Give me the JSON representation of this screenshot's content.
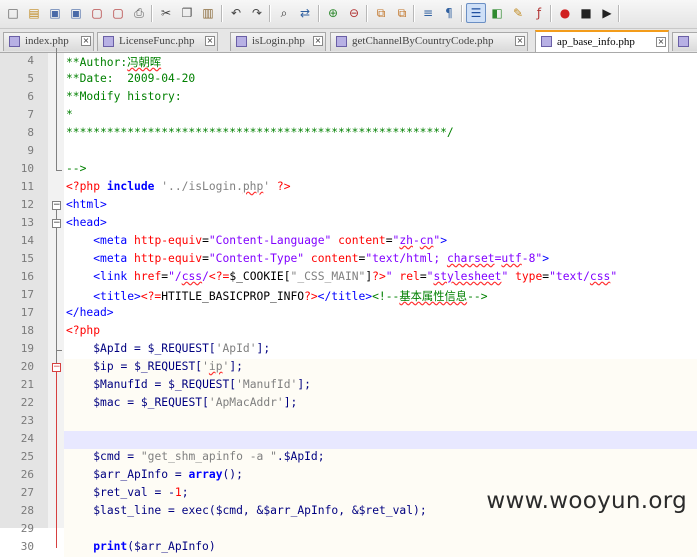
{
  "toolbar": {
    "buttons": [
      {
        "name": "new-file-icon",
        "glyph": "□",
        "color": "#5a5a5a"
      },
      {
        "name": "open-file-icon",
        "glyph": "▤",
        "color": "#c08a20"
      },
      {
        "name": "save-icon",
        "glyph": "▣",
        "color": "#4a6aa8"
      },
      {
        "name": "save-all-icon",
        "glyph": "▣",
        "color": "#4a6aa8"
      },
      {
        "name": "close-file-icon",
        "glyph": "▢",
        "color": "#b03030"
      },
      {
        "name": "close-all-icon",
        "glyph": "▢",
        "color": "#b03030"
      },
      {
        "name": "print-icon",
        "glyph": "⎙",
        "color": "#555555"
      },
      {
        "name": "cut-icon",
        "glyph": "✂",
        "color": "#444444"
      },
      {
        "name": "copy-icon",
        "glyph": "❐",
        "color": "#555555"
      },
      {
        "name": "paste-icon",
        "glyph": "▥",
        "color": "#8a6a3a"
      },
      {
        "name": "undo-icon",
        "glyph": "↶",
        "color": "#444444"
      },
      {
        "name": "redo-icon",
        "glyph": "↷",
        "color": "#444444"
      },
      {
        "name": "find-icon",
        "glyph": "⌕",
        "color": "#333333"
      },
      {
        "name": "replace-icon",
        "glyph": "⇄",
        "color": "#3060a0"
      },
      {
        "name": "zoom-in-icon",
        "glyph": "⊕",
        "color": "#2f8a2f"
      },
      {
        "name": "zoom-out-icon",
        "glyph": "⊖",
        "color": "#b03030"
      },
      {
        "name": "sync-vertical-icon",
        "glyph": "⧉",
        "color": "#c07020"
      },
      {
        "name": "sync-horizontal-icon",
        "glyph": "⧉",
        "color": "#c07020"
      },
      {
        "name": "word-wrap-icon",
        "glyph": "≡",
        "color": "#3060a0"
      },
      {
        "name": "show-all-chars-icon",
        "glyph": "¶",
        "color": "#3060a0"
      },
      {
        "name": "indent-guide-icon",
        "glyph": "☰",
        "color": "#2050a0"
      },
      {
        "name": "language-icon",
        "glyph": "◧",
        "color": "#2f8a2f"
      },
      {
        "name": "document-map-icon",
        "glyph": "✎",
        "color": "#c08a20"
      },
      {
        "name": "function-list-icon",
        "glyph": "ƒ",
        "color": "#b03030"
      },
      {
        "name": "record-macro-icon",
        "glyph": "●",
        "color": "#d02020"
      },
      {
        "name": "stop-recording-icon",
        "glyph": "■",
        "color": "#222222"
      },
      {
        "name": "playback-macro-icon",
        "glyph": "▶",
        "color": "#222222"
      }
    ]
  },
  "tabs": [
    {
      "label": "index.php",
      "close": "×",
      "active": false
    },
    {
      "label": "LicenseFunc.php",
      "close": "×",
      "active": false
    },
    {
      "label": "isLogin.php",
      "close": "×",
      "active": false
    },
    {
      "label": "getChannelByCountryCode.php",
      "close": "×",
      "active": false
    },
    {
      "label": "ap_base_info.php",
      "close": "×",
      "active": true
    },
    {
      "label": "",
      "close": "",
      "active": false
    }
  ],
  "fold": {
    "minus": "−"
  },
  "lines": [
    {
      "num": "4",
      "html": "<span class=\"c\">**Author:<span class=\"u\">冯朝晖</span></span>"
    },
    {
      "num": "5",
      "html": "<span class=\"c\">**Date:  2009-04-20</span>"
    },
    {
      "num": "6",
      "html": "<span class=\"c\">**Modify history:</span>"
    },
    {
      "num": "7",
      "html": "<span class=\"c\">*</span>"
    },
    {
      "num": "8",
      "html": "<span class=\"c\">********************************************************/</span>"
    },
    {
      "num": "9",
      "html": ""
    },
    {
      "num": "10",
      "html": "<span class=\"c\">--&gt;</span>"
    },
    {
      "num": "11",
      "html": "<span class=\"ph\">&lt;?php</span> <span class=\"k\"><b>include</b></span> <span class=\"sq\">'../isLogin.<span class=\"u\">php</span>'</span> <span class=\"ph\">?&gt;</span>"
    },
    {
      "num": "12",
      "html": "<span class=\"t\">&lt;html&gt;</span>"
    },
    {
      "num": "13",
      "html": "<span class=\"t\">&lt;head&gt;</span>"
    },
    {
      "num": "14",
      "html": "    <span class=\"t\">&lt;meta</span> <span class=\"a\">http-equiv</span>=<span class=\"av\">\"Content-Language\"</span> <span class=\"a\">content</span>=<span class=\"av\">\"<span class=\"u\">zh</span>-<span class=\"u\">cn</span>\"</span><span class=\"t\">&gt;</span>"
    },
    {
      "num": "15",
      "html": "    <span class=\"t\">&lt;meta</span> <span class=\"a\">http-equiv</span>=<span class=\"av\">\"Content-Type\"</span> <span class=\"a\">content</span>=<span class=\"av\">\"text/html; <span class=\"u\">charset</span>=<span class=\"u\">utf</span>-8\"</span><span class=\"t\">&gt;</span>"
    },
    {
      "num": "16",
      "html": "    <span class=\"t\">&lt;link</span> <span class=\"a\">href</span>=<span class=\"av\">\"/<span class=\"u\">css</span>/</span><span class=\"ph\">&lt;?=</span>$_COOKIE[<span class=\"sq\">\"_CSS_MAIN\"</span>]<span class=\"ph\">?&gt;</span><span class=\"av\">\"</span> <span class=\"a\">rel</span>=<span class=\"av\">\"<span class=\"u\">stylesheet</span>\"</span> <span class=\"a\">type</span>=<span class=\"av\">\"text/<span class=\"u\">css</span>\"</span>"
    },
    {
      "num": "17",
      "html": "    <span class=\"t\">&lt;title&gt;</span><span class=\"ph\">&lt;?=</span>HTITLE_BASICPROP_INFO<span class=\"ph\">?&gt;</span><span class=\"t\">&lt;/title&gt;</span><span class=\"c\">&lt;!--<span class=\"u\">基本属性信息</span>--&gt;</span>"
    },
    {
      "num": "17",
      "html": "<span class=\"t\">&lt;/head&gt;</span>"
    },
    {
      "num": "18",
      "html": "<span class=\"ph\">&lt;?php</span>"
    },
    {
      "num": "19",
      "html": "    <span class=\"v\">$ApId</span> <span class=\"op\">=</span> <span class=\"v\">$_REQUEST</span><span class=\"op\">[</span><span class=\"sq\">'ApId'</span><span class=\"op\">];</span>"
    },
    {
      "num": "20",
      "html": "    <span class=\"v\">$ip</span> <span class=\"op\">=</span> <span class=\"v\">$_REQUEST</span><span class=\"op\">[</span><span class=\"sq\">'<span class=\"u\">ip</span>'</span><span class=\"op\">];</span>"
    },
    {
      "num": "21",
      "html": "    <span class=\"v\">$ManufId</span> <span class=\"op\">=</span> <span class=\"v\">$_REQUEST</span><span class=\"op\">[</span><span class=\"sq\">'ManufId'</span><span class=\"op\">];</span>"
    },
    {
      "num": "22",
      "html": "    <span class=\"v\">$mac</span> <span class=\"op\">=</span> <span class=\"v\">$_REQUEST</span><span class=\"op\">[</span><span class=\"sq\">'ApMacAddr'</span><span class=\"op\">];</span>"
    },
    {
      "num": "23",
      "html": ""
    },
    {
      "num": "24",
      "html": ""
    },
    {
      "num": "25",
      "html": "    <span class=\"v\">$cmd</span> <span class=\"op\">=</span> <span class=\"s\">\"get_shm_apinfo -a \"</span><span class=\"op\">.</span><span class=\"v\">$ApId</span><span class=\"op\">;</span>"
    },
    {
      "num": "26",
      "html": "    <span class=\"v\">$arr_ApInfo</span> <span class=\"op\">=</span> <span class=\"k\"><b>array</b></span><span class=\"op\">();</span>"
    },
    {
      "num": "27",
      "html": "    <span class=\"v\">$ret_val</span> <span class=\"op\">=</span> <span class=\"op\">-</span><span class=\"ph\">1</span><span class=\"op\">;</span>"
    },
    {
      "num": "28",
      "html": "    <span class=\"v\">$last_line</span> <span class=\"op\">=</span> <span class=\"fn\">exec</span><span class=\"op\">(</span><span class=\"v\">$cmd</span><span class=\"op\">,</span> <span class=\"op\">&amp;</span><span class=\"v\">$arr_ApInfo</span><span class=\"op\">,</span> <span class=\"op\">&amp;</span><span class=\"v\">$ret_val</span><span class=\"op\">);</span>"
    },
    {
      "num": "29",
      "html": ""
    },
    {
      "num": "30",
      "html": "    <span class=\"k\"><b>print</b></span><span class=\"op\">(</span><span class=\"v\">$arr_ApInfo</span><span class=\"op\">)</span>"
    }
  ],
  "watermark": "www.wooyun.org"
}
